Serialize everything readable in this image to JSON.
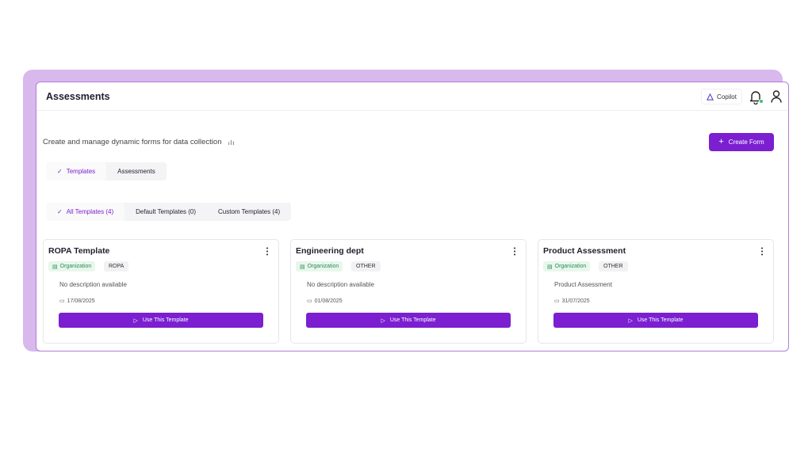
{
  "header": {
    "title": "Assessments",
    "copilot_label": "Copilot"
  },
  "page": {
    "subtitle": "Create and manage dynamic forms for data collection",
    "create_button": "Create Form"
  },
  "main_tabs": [
    {
      "label": "Templates",
      "active": true
    },
    {
      "label": "Assessments",
      "active": false
    }
  ],
  "filter_tabs": [
    {
      "label": "All Templates (4)",
      "active": true
    },
    {
      "label": "Default Templates (0)",
      "active": false
    },
    {
      "label": "Custom Templates (4)",
      "active": false
    }
  ],
  "cards": [
    {
      "title": "ROPA Template",
      "badge": "Organization",
      "tag": "ROPA",
      "description": "No description available",
      "date": "17/08/2025",
      "button": "Use This Template"
    },
    {
      "title": "Engineering dept",
      "badge": "Organization",
      "tag": "OTHER",
      "description": "No description available",
      "date": "01/08/2025",
      "button": "Use This Template"
    },
    {
      "title": "Product Assessment",
      "badge": "Organization",
      "tag": "OTHER",
      "description": "Product Assessment",
      "date": "31/07/2025",
      "button": "Use This Template"
    }
  ],
  "colors": {
    "accent": "#7b1fd1",
    "backdrop": "#d9b8ee",
    "badge_green": "#2e8b57",
    "notification_dot": "#2ecc71"
  }
}
